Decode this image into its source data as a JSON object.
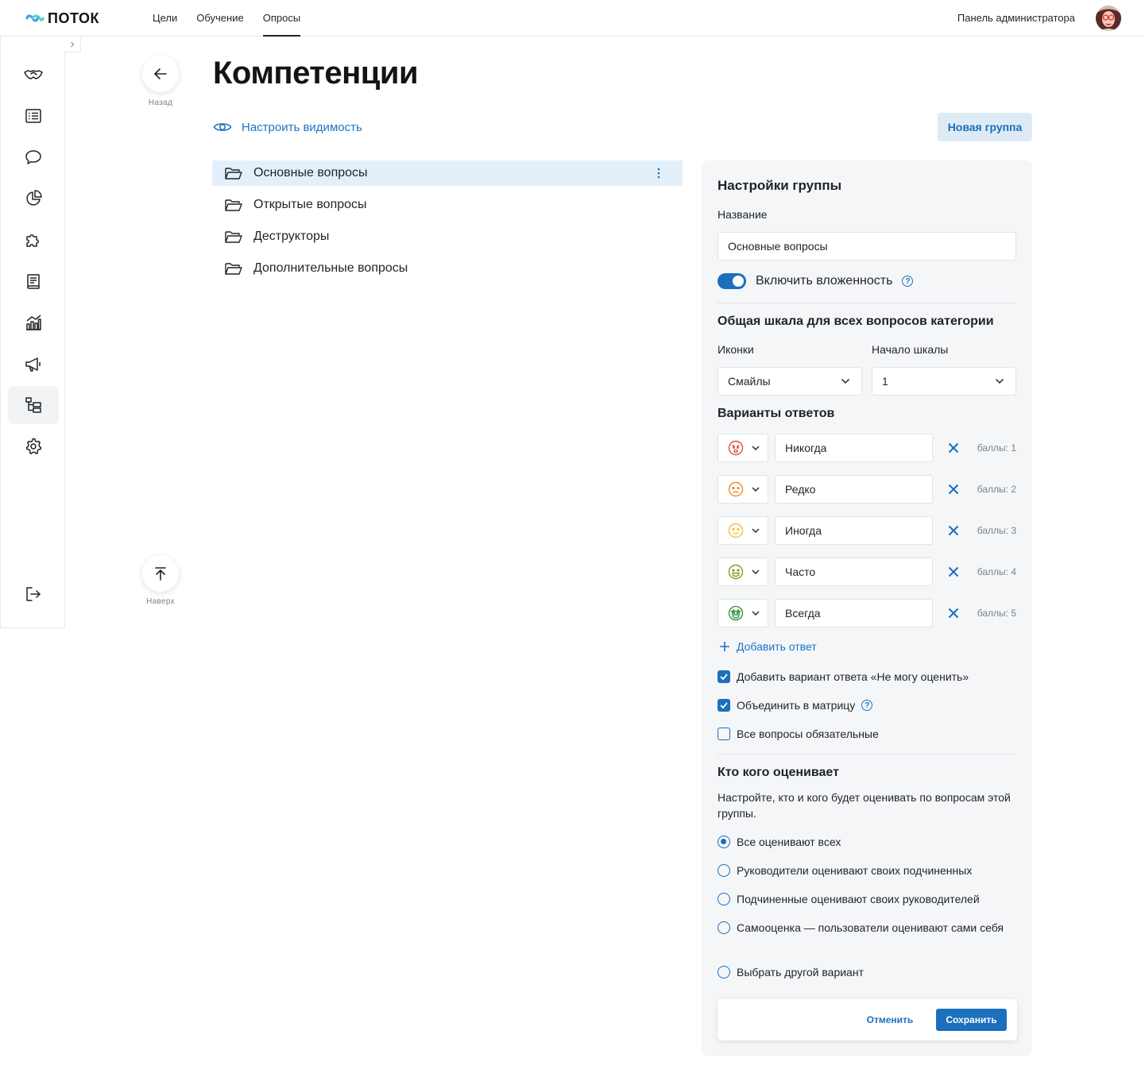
{
  "header": {
    "logo_text": "ПОТОК",
    "nav": [
      {
        "label": "Цели"
      },
      {
        "label": "Обучение"
      },
      {
        "label": "Опросы"
      }
    ],
    "admin_label": "Панель администратора"
  },
  "sidebar": {
    "items": [
      "handshake-icon",
      "list-icon",
      "chat-icon",
      "pie-chart-icon",
      "puzzle-icon",
      "book-icon",
      "analytics-icon",
      "megaphone-icon",
      "structure-icon",
      "gear-icon"
    ],
    "logout": "logout-icon"
  },
  "nav_buttons": {
    "back_label": "Назад",
    "top_label": "Наверх"
  },
  "page": {
    "title": "Компетенции",
    "visibility_label": "Настроить видимость",
    "new_group_label": "Новая группа"
  },
  "groups": [
    {
      "label": "Основные вопросы"
    },
    {
      "label": "Открытые вопросы"
    },
    {
      "label": "Деструкторы"
    },
    {
      "label": "Дополнительные вопросы"
    }
  ],
  "settings": {
    "title": "Настройки группы",
    "name_label": "Название",
    "name_value": "Основные вопросы",
    "nesting_label": "Включить вложенность",
    "scale_title": "Общая шкала для всех вопросов категории",
    "icons_label": "Иконки",
    "icons_value": "Смайлы",
    "scale_start_label": "Начало шкалы",
    "scale_start_value": "1",
    "answers_title": "Варианты ответов",
    "answers": [
      {
        "text": "Никогда",
        "points": "баллы: 1",
        "color": "#e5484d"
      },
      {
        "text": "Редко",
        "points": "баллы: 2",
        "color": "#f08c2e"
      },
      {
        "text": "Иногда",
        "points": "баллы: 3",
        "color": "#f2c230"
      },
      {
        "text": "Часто",
        "points": "баллы: 4",
        "color": "#8a9a1b"
      },
      {
        "text": "Всегда",
        "points": "баллы: 5",
        "color": "#2e8b3e"
      }
    ],
    "add_answer_label": "Добавить ответ",
    "checkboxes": [
      {
        "label": "Добавить вариант ответа «Не могу оценить»",
        "checked": true
      },
      {
        "label": "Объединить в матрицу",
        "checked": true
      },
      {
        "label": "Все вопросы обязательные",
        "checked": false
      }
    ],
    "who_title": "Кто кого оценивает",
    "who_desc": "Настройте, кто и кого будет оценивать по вопросам этой группы.",
    "radios": [
      {
        "label": "Все оценивают всех",
        "selected": true
      },
      {
        "label": "Руководители оценивают своих подчиненных",
        "selected": false
      },
      {
        "label": "Подчиненные оценивают своих руководителей",
        "selected": false
      },
      {
        "label": "Самооценка — пользователи оценивают сами себя",
        "selected": false
      },
      {
        "label": "Выбрать другой вариант",
        "selected": false
      }
    ],
    "cancel_label": "Отменить",
    "save_label": "Сохранить"
  }
}
